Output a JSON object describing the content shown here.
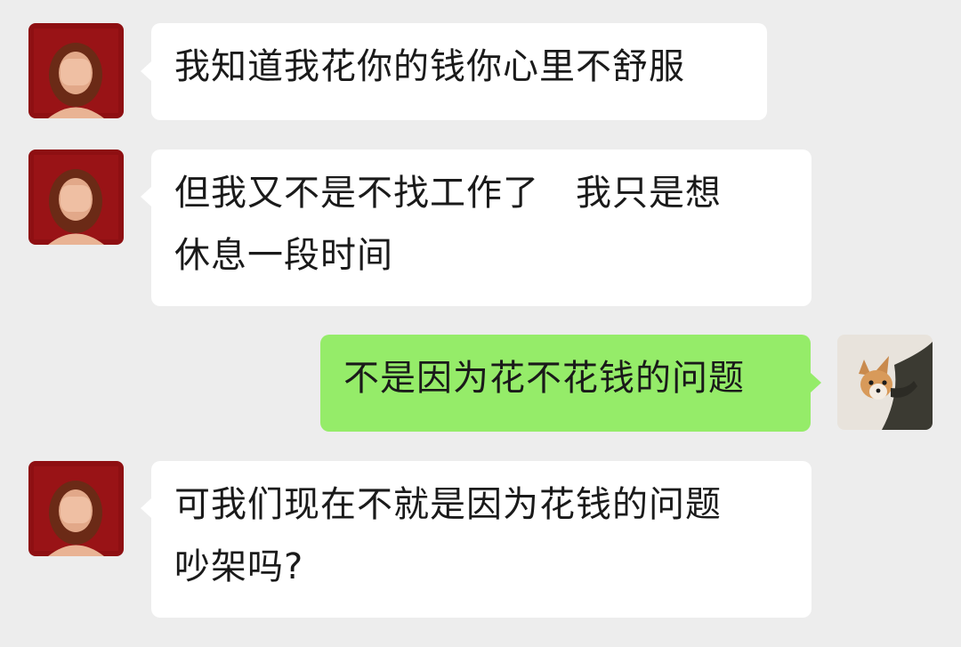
{
  "conversation": {
    "messages": [
      {
        "sender": "contact",
        "lines": [
          "我知道我花你的钱你心里不舒服"
        ]
      },
      {
        "sender": "contact",
        "lines": [
          "但我又不是不找工作了　我只是想",
          "休息一段时间"
        ]
      },
      {
        "sender": "self",
        "lines": [
          "不是因为花不花钱的问题"
        ]
      },
      {
        "sender": "contact",
        "lines": [
          "可我们现在不就是因为花钱的问题",
          "吵架吗?"
        ]
      }
    ]
  },
  "colors": {
    "background": "#ededed",
    "incoming_bubble": "#ffffff",
    "outgoing_bubble": "#95ec69",
    "text": "#1a1a1a"
  },
  "icons": {
    "contact_avatar": "woman-covering-face-avatar",
    "self_avatar": "corgi-dog-avatar"
  }
}
